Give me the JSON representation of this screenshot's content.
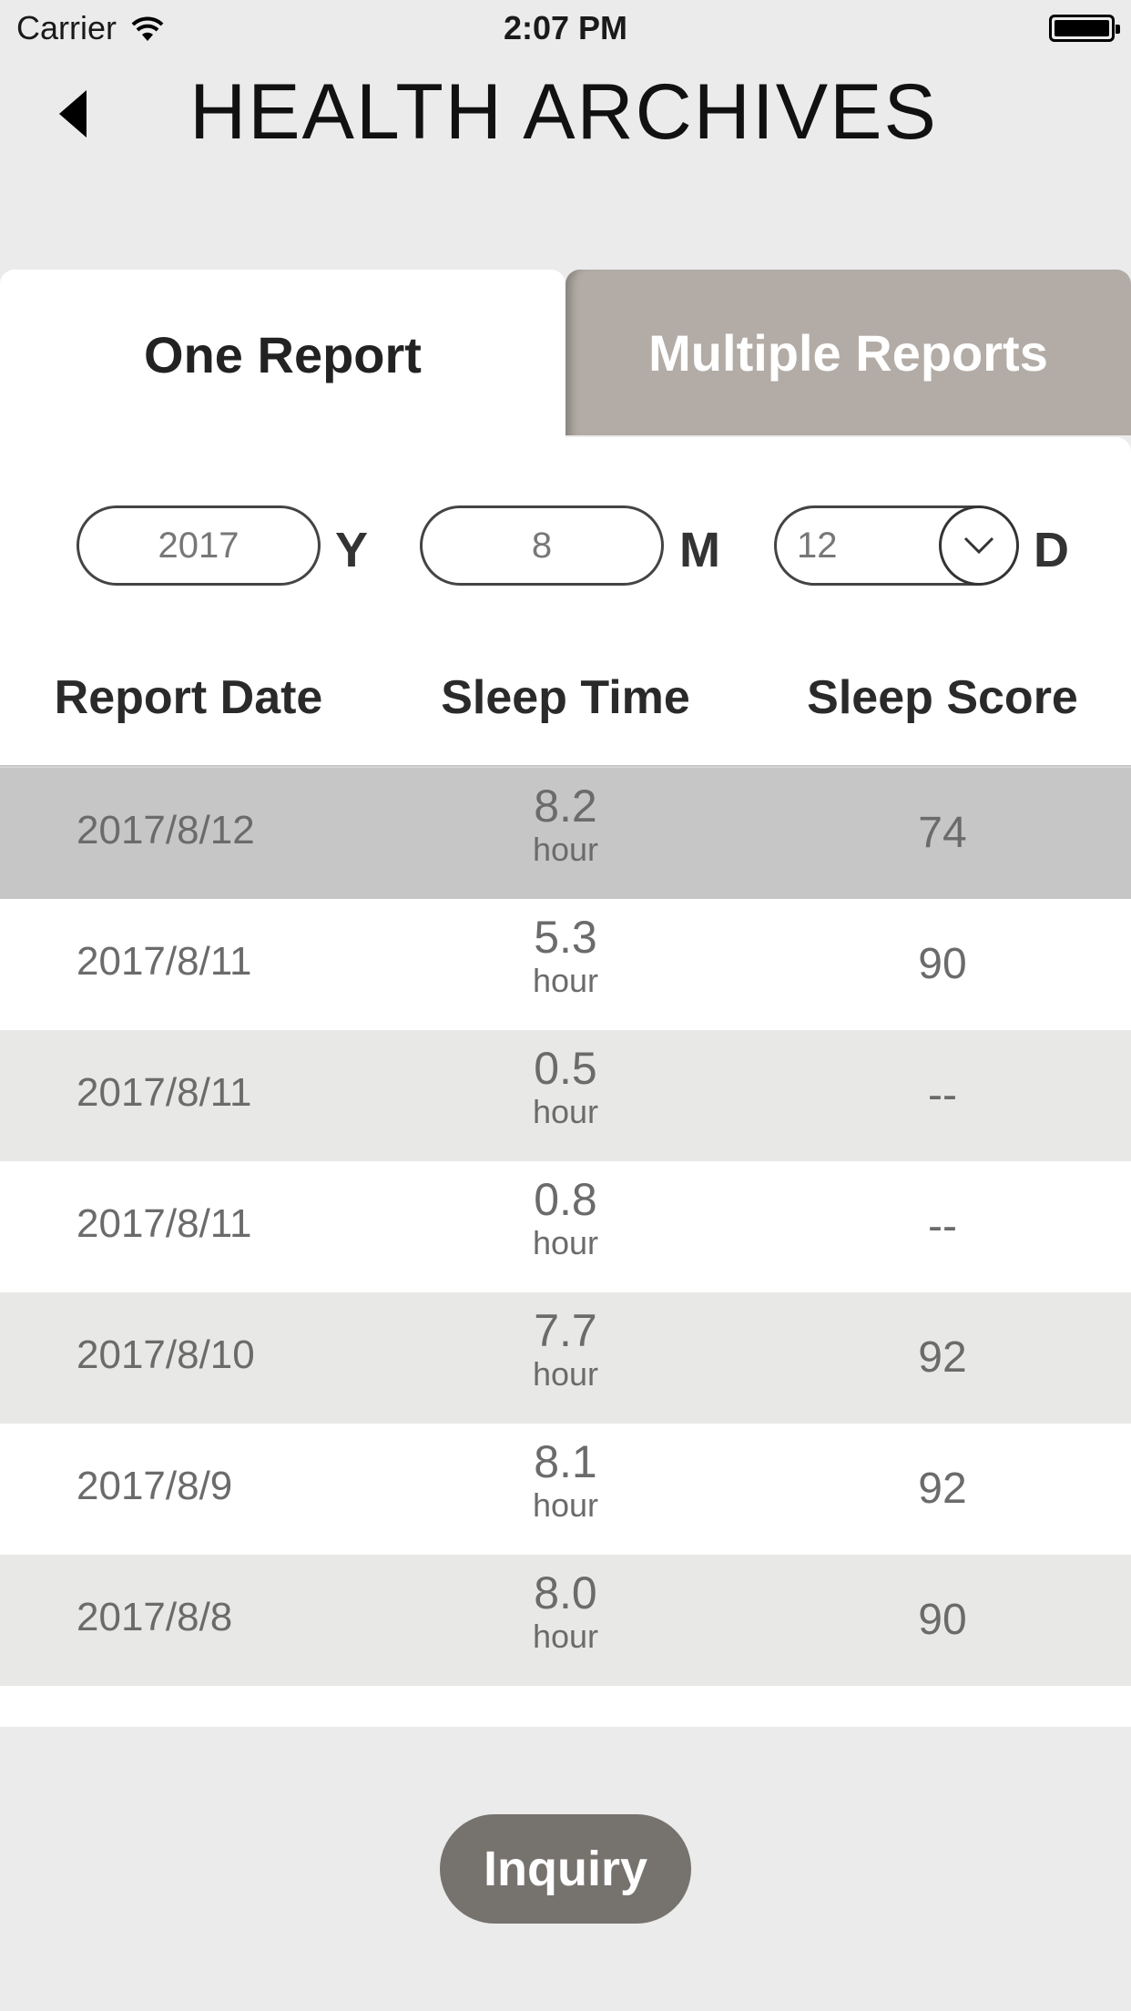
{
  "status_bar": {
    "carrier": "Carrier",
    "time": "2:07 PM"
  },
  "header": {
    "title": "HEALTH ARCHIVES"
  },
  "tabs": [
    {
      "label": "One Report",
      "active": true
    },
    {
      "label": "Multiple Reports",
      "active": false
    }
  ],
  "date_filter": {
    "year": "2017",
    "year_unit": "Y",
    "month": "8",
    "month_unit": "M",
    "day": "12",
    "day_unit": "D"
  },
  "table": {
    "headers": [
      "Report Date",
      "Sleep Time",
      "Sleep Score"
    ],
    "unit_label": "hour",
    "rows": [
      {
        "date": "2017/8/12",
        "sleep_time": "8.2",
        "unit": "hour",
        "score": "74"
      },
      {
        "date": "2017/8/11",
        "sleep_time": "5.3",
        "unit": "hour",
        "score": "90"
      },
      {
        "date": "2017/8/11",
        "sleep_time": "0.5",
        "unit": "hour",
        "score": "--"
      },
      {
        "date": "2017/8/11",
        "sleep_time": "0.8",
        "unit": "hour",
        "score": "--"
      },
      {
        "date": "2017/8/10",
        "sleep_time": "7.7",
        "unit": "hour",
        "score": "92"
      },
      {
        "date": "2017/8/9",
        "sleep_time": "8.1",
        "unit": "hour",
        "score": "92"
      },
      {
        "date": "2017/8/8",
        "sleep_time": "8.0",
        "unit": "hour",
        "score": "90"
      }
    ]
  },
  "actions": {
    "inquiry_label": "Inquiry"
  },
  "colors": {
    "background": "#ebebeb",
    "tab_inactive": "#b3aca6",
    "selected_row": "#c6c6c6",
    "alt_row": "#e8e8e6",
    "button": "#76726e"
  }
}
